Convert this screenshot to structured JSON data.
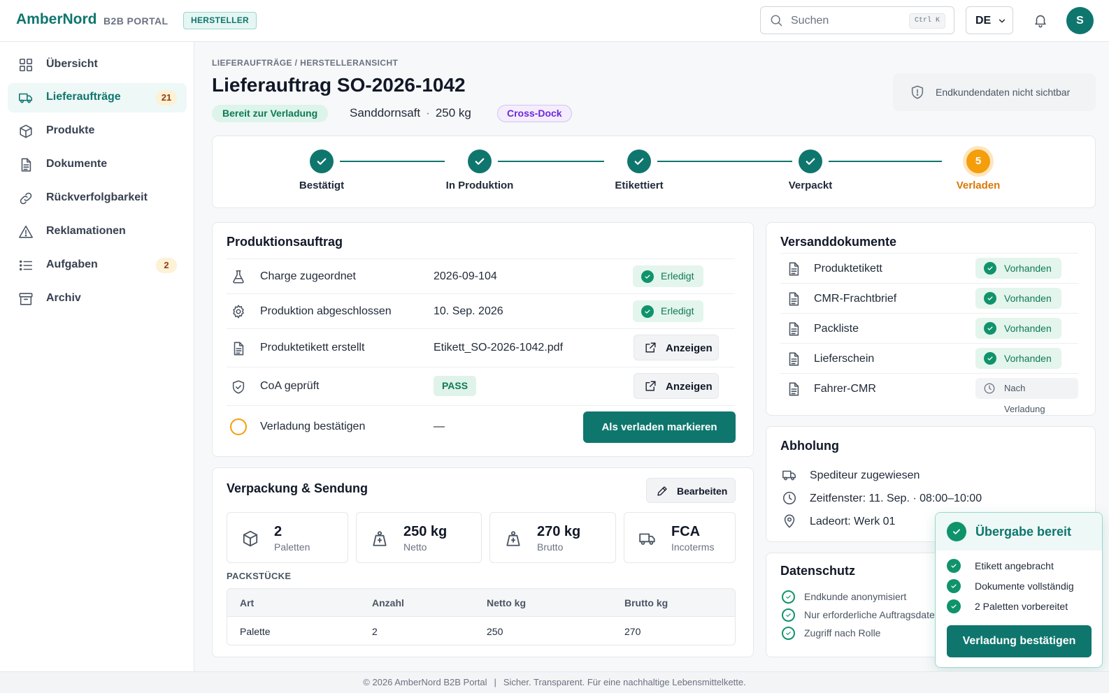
{
  "header": {
    "logo": "AmberNord",
    "portal_label": "B2B PORTAL",
    "role_badge": "HERSTELLER",
    "search_placeholder": "Suchen",
    "search_shortcut": "Ctrl K",
    "language": "DE",
    "avatar_initial": "S"
  },
  "sidebar": {
    "items": [
      {
        "label": "Übersicht",
        "icon": "grid-icon"
      },
      {
        "label": "Lieferaufträge",
        "icon": "truck-icon",
        "count": "21",
        "active": true
      },
      {
        "label": "Produkte",
        "icon": "box-icon"
      },
      {
        "label": "Dokumente",
        "icon": "document-icon"
      },
      {
        "label": "Rückverfolgbarkeit",
        "icon": "link-icon"
      },
      {
        "label": "Reklamationen",
        "icon": "warning-icon"
      },
      {
        "label": "Aufgaben",
        "icon": "list-icon",
        "count": "2"
      },
      {
        "label": "Archiv",
        "icon": "archive-icon"
      }
    ]
  },
  "page": {
    "breadcrumb": "LIEFERAUFTRÄGE / HERSTELLERANSICHT",
    "title": "Lieferauftrag SO-2026-1042",
    "status": "Bereit zur Verladung",
    "product": "Sanddornsaft",
    "separator": "·",
    "weight": "250 kg",
    "tag": "Cross-Dock",
    "privacy_note": "Endkundendaten nicht sichtbar"
  },
  "stepper": {
    "steps": [
      {
        "label": "Bestätigt",
        "state": "done"
      },
      {
        "label": "In Produktion",
        "state": "done"
      },
      {
        "label": "Etikettiert",
        "state": "done"
      },
      {
        "label": "Verpackt",
        "state": "done"
      },
      {
        "label": "Verladen",
        "state": "current",
        "number": "5"
      }
    ],
    "colors": {
      "done": "#0f766e",
      "current": "#f59e0b"
    }
  },
  "production": {
    "title": "Produktionsauftrag",
    "rows": [
      {
        "label": "Charge zugeordnet",
        "value": "2026-09-104",
        "status": "Erledigt",
        "icon": "flask-icon"
      },
      {
        "label": "Produktion abgeschlossen",
        "value": "10. Sep. 2026",
        "status": "Erledigt",
        "icon": "gear-icon"
      },
      {
        "label": "Produktetikett erstellt",
        "value": "Etikett_SO-2026-1042.pdf",
        "action": "Anzeigen",
        "icon": "document-icon"
      },
      {
        "label": "CoA geprüft",
        "value": "PASS",
        "action": "Anzeigen",
        "icon": "shield-check-icon"
      },
      {
        "label": "Verladung bestätigen",
        "value": "—",
        "action": "Als verladen markieren",
        "icon": "pending-circle-icon"
      }
    ]
  },
  "packing": {
    "title": "Verpackung & Sendung",
    "edit_label": "Bearbeiten",
    "stats": [
      {
        "value": "2",
        "label": "Paletten",
        "icon": "box-icon"
      },
      {
        "value": "250 kg",
        "label": "Netto",
        "icon": "weight-icon"
      },
      {
        "value": "270 kg",
        "label": "Brutto",
        "icon": "weight-icon"
      },
      {
        "value": "FCA",
        "label": "Incoterms",
        "icon": "truck-icon"
      }
    ],
    "section_label": "PACKSTÜCKE",
    "table": {
      "headers": [
        "Art",
        "Anzahl",
        "Netto kg",
        "Brutto kg"
      ],
      "rows": [
        [
          "Palette",
          "2",
          "250",
          "270"
        ]
      ]
    }
  },
  "documents": {
    "title": "Versanddokumente",
    "items": [
      {
        "name": "Produktetikett",
        "status": "Vorhanden"
      },
      {
        "name": "CMR-Frachtbrief",
        "status": "Vorhanden"
      },
      {
        "name": "Packliste",
        "status": "Vorhanden"
      },
      {
        "name": "Lieferschein",
        "status": "Vorhanden"
      },
      {
        "name": "Fahrer-CMR",
        "status": "Nach Verladung"
      }
    ]
  },
  "pickup": {
    "title": "Abholung",
    "carrier": "Spediteur zugewiesen",
    "window": "Zeitfenster: 11. Sep. · 08:00–10:00",
    "location": "Ladeort: Werk 01"
  },
  "privacy": {
    "title": "Datenschutz",
    "items": [
      "Endkunde anonymisiert",
      "Nur erforderliche Auftragsdaten",
      "Zugriff nach Rolle"
    ]
  },
  "handover": {
    "title": "Übergabe bereit",
    "items": [
      "Etikett angebracht",
      "Dokumente vollständig",
      "2 Paletten vorbereitet"
    ],
    "button": "Verladung bestätigen"
  },
  "footer": {
    "copyright": "© 2026 AmberNord B2B Portal",
    "separator": "|",
    "tagline": "Sicher. Transparent. Für eine nachhaltige Lebensmittelkette."
  }
}
